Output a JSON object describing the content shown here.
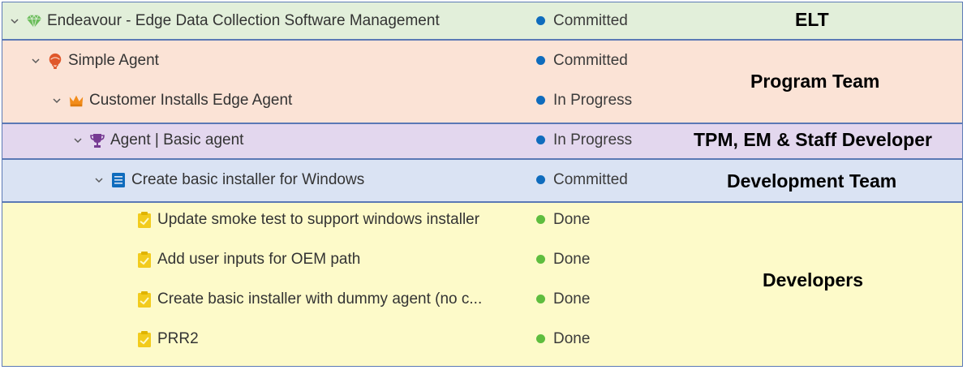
{
  "colors": {
    "elt_band": "#e2efda",
    "program_band": "#fbe3d6",
    "tpm_band": "#e3d7ee",
    "dev_band": "#dae3f3",
    "developers_band": "#fdfac9",
    "committed_dot": "#0f6cbd",
    "in_progress_dot": "#0f6cbd",
    "done_dot": "#5ebd3e"
  },
  "band_labels": {
    "elt": "ELT",
    "program": "Program Team",
    "tpm": "TPM, EM & Staff Developer",
    "development": "Development Team",
    "developers": "Developers"
  },
  "work_items": [
    {
      "type_icon": "epic-gem-icon",
      "title": "Endeavour - Edge Data Collection Software Management",
      "state": "Committed"
    },
    {
      "type_icon": "initiative-icon",
      "title": "Simple Agent",
      "state": "Committed"
    },
    {
      "type_icon": "crown-icon",
      "title": "Customer Installs Edge Agent",
      "state": "In Progress"
    },
    {
      "type_icon": "trophy-icon",
      "title": "Agent | Basic agent",
      "state": "In Progress"
    },
    {
      "type_icon": "backlog-item-icon",
      "title": "Create basic installer for Windows",
      "state": "Committed"
    },
    {
      "type_icon": "task-icon",
      "title": "Update smoke test to support windows installer",
      "state": "Done"
    },
    {
      "type_icon": "task-icon",
      "title": "Add user inputs for OEM path",
      "state": "Done"
    },
    {
      "type_icon": "task-icon",
      "title": "Create basic installer with dummy agent (no c...",
      "state": "Done"
    },
    {
      "type_icon": "task-icon",
      "title": "PRR2",
      "state": "Done"
    }
  ]
}
